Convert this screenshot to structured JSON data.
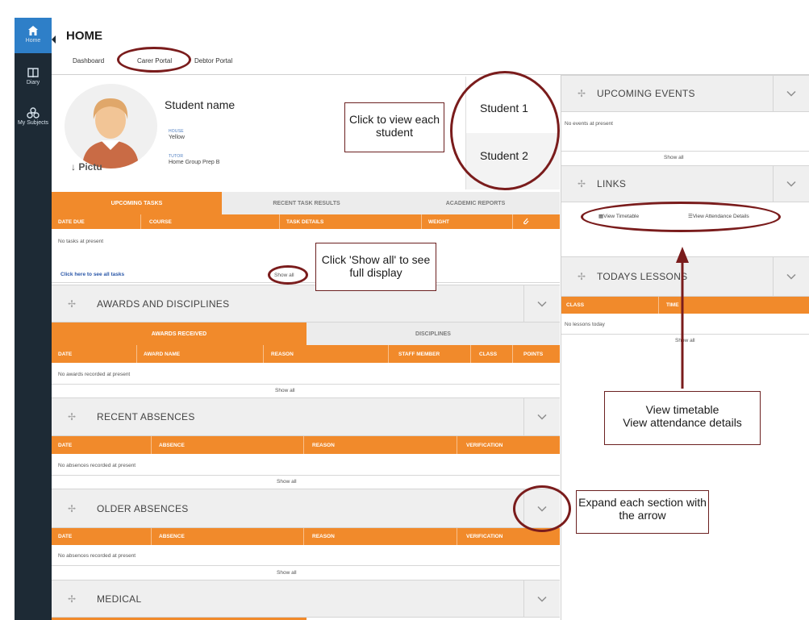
{
  "nav": {
    "items": [
      {
        "label": "Home",
        "icon": "home-icon"
      },
      {
        "label": "Diary",
        "icon": "book-icon"
      },
      {
        "label": "My Subjects",
        "icon": "subjects-icon"
      }
    ]
  },
  "header": {
    "title": "HOME",
    "tabs": [
      "Dashboard",
      "Carer Portal",
      "Debtor Portal"
    ]
  },
  "student": {
    "name": "Student name",
    "picture_caption": "↓ Pictu",
    "house_label": "HOUSE",
    "house": "Yellow",
    "tutor_label": "TUTOR",
    "tutor": "Home Group Prep B",
    "selector": [
      "Student 1",
      "Student 2"
    ]
  },
  "tasks": {
    "tabs": [
      "UPCOMING TASKS",
      "RECENT TASK RESULTS",
      "ACADEMIC REPORTS"
    ],
    "columns": [
      "DATE DUE",
      "COURSE",
      "TASK DETAILS",
      "WEIGHT"
    ],
    "empty": "No tasks at present",
    "see_all_link": "Click here to see all tasks",
    "show_all": "Show all"
  },
  "awards": {
    "title": "AWARDS AND DISCIPLINES",
    "tabs": [
      "AWARDS RECEIVED",
      "DISCIPLINES"
    ],
    "columns": [
      "DATE",
      "AWARD NAME",
      "REASON",
      "STAFF MEMBER",
      "CLASS",
      "POINTS"
    ],
    "empty": "No awards recorded at present",
    "show_all": "Show all"
  },
  "recent_absences": {
    "title": "RECENT ABSENCES",
    "columns": [
      "DATE",
      "ABSENCE",
      "REASON",
      "VERIFICATION"
    ],
    "empty": "No absences recorded at present",
    "show_all": "Show all"
  },
  "older_absences": {
    "title": "OLDER ABSENCES",
    "columns": [
      "DATE",
      "ABSENCE",
      "REASON",
      "VERIFICATION"
    ],
    "empty": "No absences recorded at present",
    "show_all": "Show all"
  },
  "medical": {
    "title": "MEDICAL"
  },
  "upcoming_events": {
    "title": "UPCOMING EVENTS",
    "empty": "No events at present",
    "show_all": "Show all"
  },
  "links": {
    "title": "LINKS",
    "timetable": "View Timetable",
    "attendance": "View Attendance Details"
  },
  "todays_lessons": {
    "title": "TODAYS LESSONS",
    "columns": [
      "CLASS",
      "TIME"
    ],
    "empty": "No lessons today",
    "show_all": "Show all"
  },
  "callouts": {
    "view_student": "Click to view each student",
    "show_all": "Click 'Show all' to see full display",
    "links": "View timetable\nView attendance details",
    "expand": "Expand each section with the arrow"
  },
  "colors": {
    "accent": "#f18a2b",
    "nav_bg": "#1d2a35",
    "nav_active": "#2e7fc8",
    "annotation": "#7a1c1c"
  }
}
